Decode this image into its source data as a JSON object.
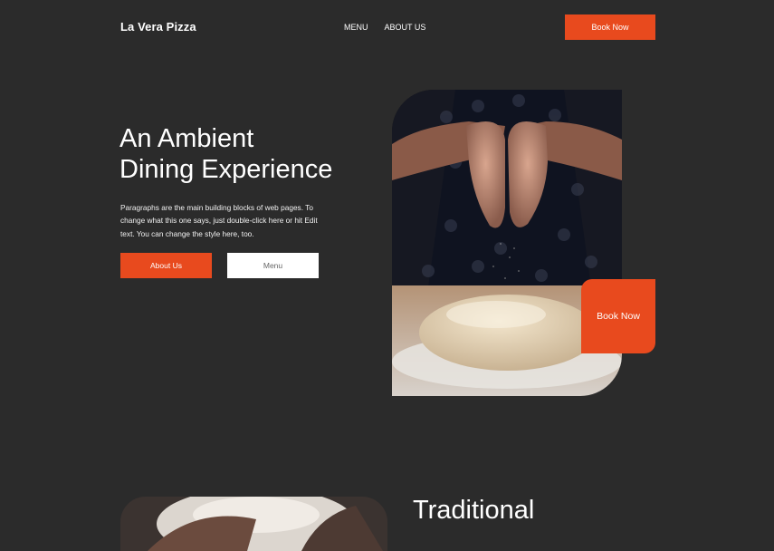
{
  "header": {
    "brand": "La Vera Pizza",
    "nav": [
      {
        "label": "MENU"
      },
      {
        "label": "ABOUT US"
      }
    ],
    "cta_label": "Book Now"
  },
  "hero": {
    "title_line1": "An Ambient",
    "title_line2": "Dining Experience",
    "paragraph": "Paragraphs are the main building blocks of web pages. To change what this one says, just double-click here or hit Edit text. You can change the style here, too.",
    "primary_button": "About Us",
    "secondary_button": "Menu",
    "badge_label": "Book Now"
  },
  "section2": {
    "title": "Traditional"
  },
  "colors": {
    "accent": "#e84a1e",
    "background": "#2b2b2b",
    "text": "#ffffff"
  }
}
